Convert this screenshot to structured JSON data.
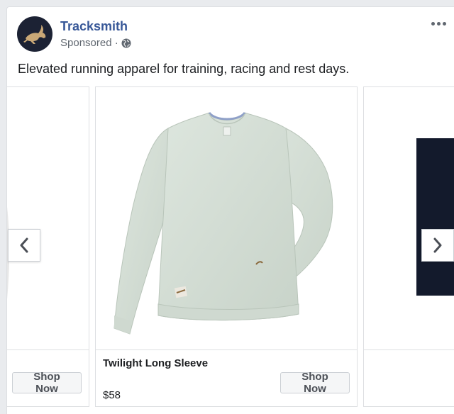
{
  "post": {
    "brand_name": "Tracksmith",
    "sponsored_label": "Sponsored ·",
    "caption": "Elevated running apparel for training, racing and rest days."
  },
  "icons": {
    "avatar": "hare-logo-icon",
    "privacy": "globe-icon",
    "menu": "more-options-icon",
    "prev": "chevron-left-icon",
    "next": "chevron-right-icon"
  },
  "carousel": {
    "cards": [
      {
        "title": "",
        "price": "",
        "cta": "Shop Now"
      },
      {
        "title": "Twilight Long Sleeve",
        "price": "$58",
        "cta": "Shop Now"
      },
      {
        "title": "",
        "price": "",
        "cta": ""
      }
    ]
  },
  "colors": {
    "brand_link": "#385898",
    "product_shirt": "#d3ddd4",
    "avatar_bg": "#1c2234"
  }
}
